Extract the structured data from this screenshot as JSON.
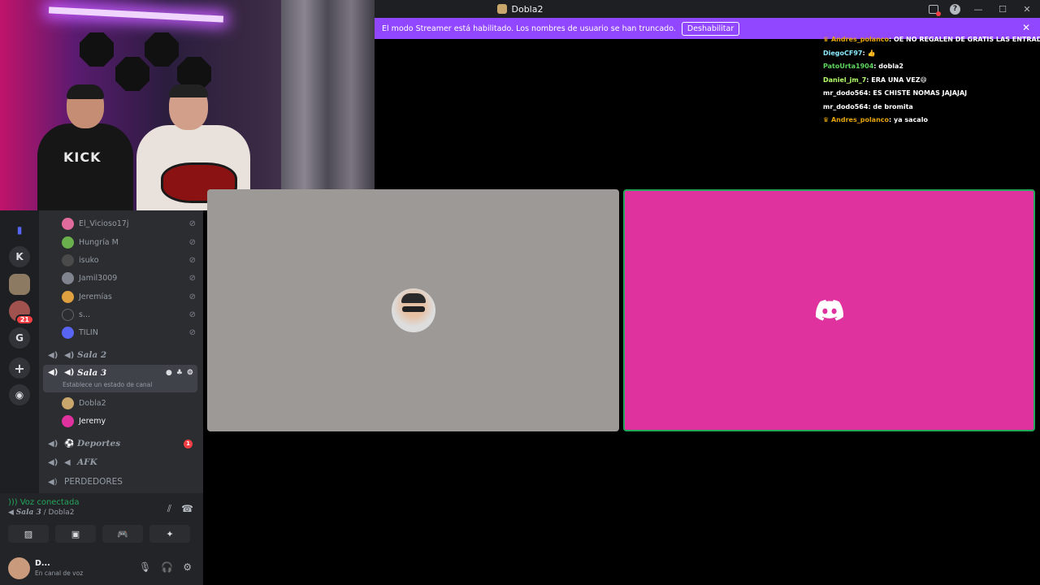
{
  "window": {
    "title": "Dobla2"
  },
  "banner": {
    "text": "El modo Streamer está habilitado. Los nombres de usuario se han truncado.",
    "button": "Deshabilitar"
  },
  "rail": {
    "items": [
      "K",
      "G"
    ],
    "badge": "21"
  },
  "members_top": [
    {
      "name": "El_Vicioso17j",
      "color": "#e06b9c"
    },
    {
      "name": "Hungría M",
      "color": "#6ab04c"
    },
    {
      "name": "isuko",
      "color": "#444"
    },
    {
      "name": "Jamil3009",
      "color": "#80848e"
    },
    {
      "name": "Jeremías",
      "color": "#e0a040"
    },
    {
      "name": "s...",
      "color": "#2b2d31"
    },
    {
      "name": "TILIN",
      "color": "#5865f2"
    }
  ],
  "channels": {
    "sala2": "Sala 2",
    "sala3": "Sala 3",
    "sala3_status": "Establece un estado de canal",
    "deportes": "Deportes",
    "deportes_badge": "1",
    "afk": "AFK",
    "perdedores": "PERDEDORES"
  },
  "sala3_members": [
    {
      "name": "Dobla2",
      "color": "#c9a66b"
    },
    {
      "name": "Jeremy",
      "color": "#e0329e"
    }
  ],
  "voice": {
    "status": "Voz conectada",
    "channel": "Sala 3",
    "server": "/ Dobla2"
  },
  "user": {
    "name": "D...",
    "sub": "En canal de voz"
  },
  "chat": [
    {
      "user": "Andres_polanco",
      "color": "#e5a50a",
      "crown": true,
      "text": "OE NO REGALEN DE GRATIS LAS ENTRADAS"
    },
    {
      "user": "DiegoCF97",
      "color": "#8be9fd",
      "crown": false,
      "text": "👍"
    },
    {
      "user": "PatoUrta1904",
      "color": "#5cd65c",
      "crown": false,
      "text": "dobla2"
    },
    {
      "user": "Daniel_jm_7",
      "color": "#b5ff6b",
      "crown": false,
      "text": "ERA UNA VEZ😄"
    },
    {
      "user": "mr_dodo564",
      "color": "#ffffff",
      "crown": false,
      "text": "ES CHISTE NOMAS JAJAJAJ"
    },
    {
      "user": "mr_dodo564",
      "color": "#ffffff",
      "crown": false,
      "text": "de bromita"
    },
    {
      "user": "Andres_polanco",
      "color": "#e5a50a",
      "crown": true,
      "text": "ya sacalo"
    }
  ],
  "icons": {
    "speaker": "speaker-icon",
    "muted": "mic-muted-icon",
    "gear": "gear-icon"
  }
}
